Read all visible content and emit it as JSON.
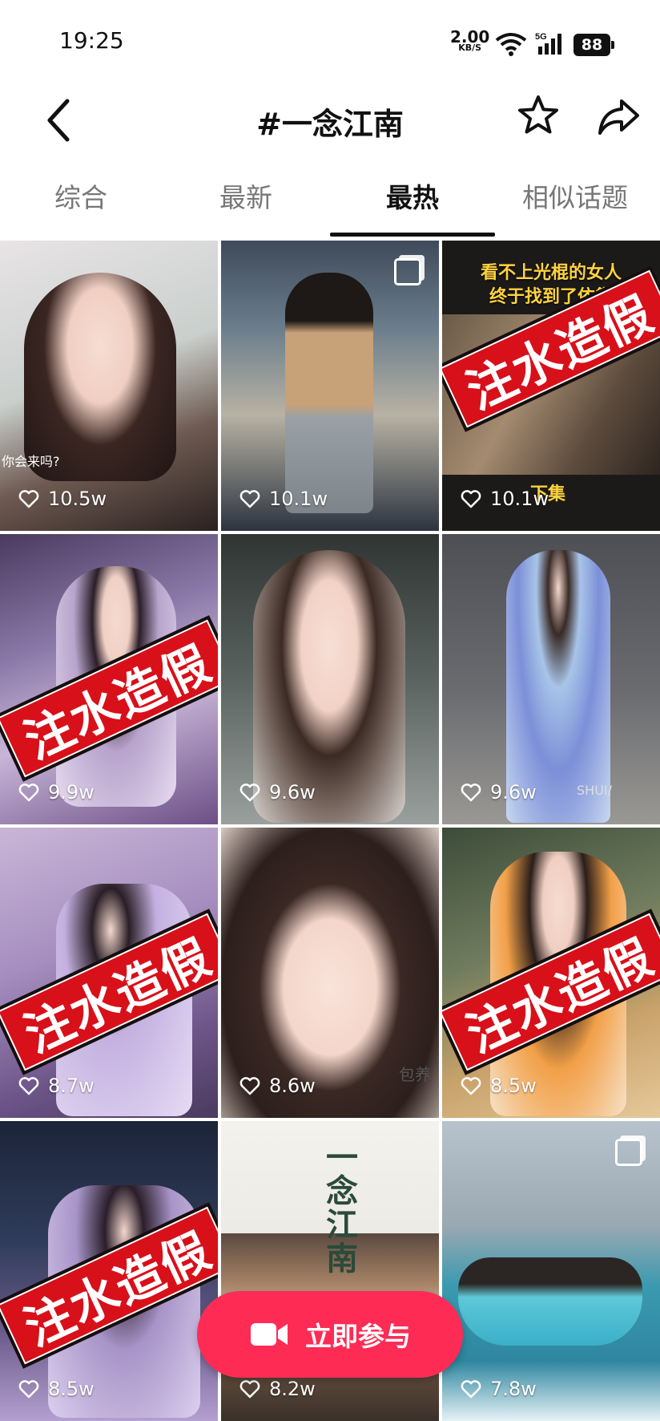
{
  "status": {
    "time": "19:25",
    "net_speed": "2.00",
    "net_unit": "KB/S",
    "network": "5G",
    "battery": "88"
  },
  "header": {
    "title": "#一念江南"
  },
  "tabs": [
    {
      "label": "综合"
    },
    {
      "label": "最新"
    },
    {
      "label": "最热",
      "active": true
    },
    {
      "label": "相似话题"
    }
  ],
  "cards": [
    {
      "likes": "10.5w",
      "caption": "你会来吗?"
    },
    {
      "likes": "10.1w"
    },
    {
      "likes": "10.1w",
      "overlay": "看不上光棍的女人\n终于找到了依靠",
      "tag": "下集",
      "stamp": "注水造假"
    },
    {
      "likes": "9.9w",
      "stamp": "注水造假"
    },
    {
      "likes": "9.6w"
    },
    {
      "likes": "9.6w",
      "watermark": "SHUI/"
    },
    {
      "likes": "8.7w",
      "stamp": "注水造假"
    },
    {
      "likes": "8.6w",
      "watermark": "包养"
    },
    {
      "likes": "8.5w",
      "stamp": "注水造假"
    },
    {
      "likes": "8.5w",
      "stamp": "注水造假"
    },
    {
      "likes": "8.2w",
      "calligraphy": "一念江南"
    },
    {
      "likes": "7.8w"
    }
  ],
  "join_button": {
    "label": "立即参与"
  },
  "colors": {
    "accent": "#fe2c55",
    "stamp_red": "#d8101a"
  }
}
